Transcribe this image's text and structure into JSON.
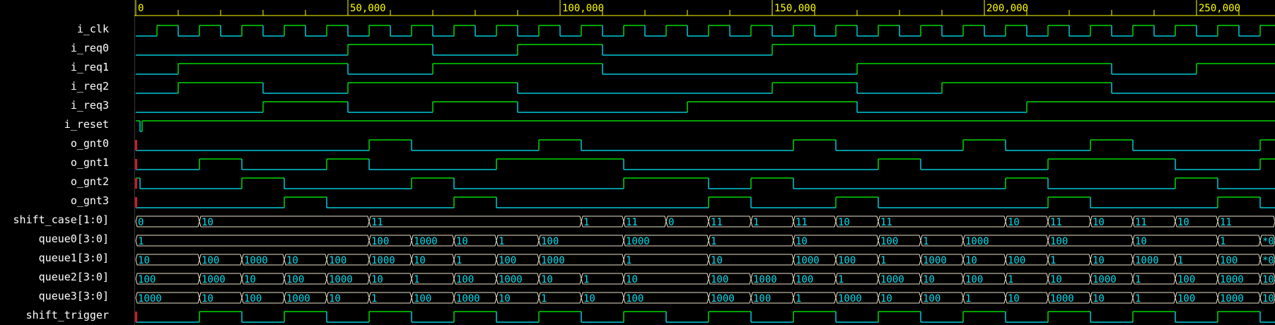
{
  "colors": {
    "background": "#000000",
    "ruler": "#ffff00",
    "wave_high": "#00d800",
    "wave_low": "#00c8d8",
    "bus_border": "#e8e0c8",
    "bus_text": "#00e0f0",
    "name_text": "#ffffff",
    "marker": "#d01830"
  },
  "ruler": {
    "t_min": 0,
    "t_max": 270000,
    "labels": [
      {
        "t": 0,
        "text": "0"
      },
      {
        "t": 50000,
        "text": "50,000"
      },
      {
        "t": 100000,
        "text": "100,000"
      },
      {
        "t": 150000,
        "text": "150,000"
      },
      {
        "t": 200000,
        "text": "200,000"
      },
      {
        "t": 250000,
        "text": "250,000"
      }
    ]
  },
  "signals": [
    {
      "name": "i_clk",
      "kind": "bit",
      "edges": [
        [
          0,
          0
        ],
        [
          5000,
          1
        ],
        [
          10000,
          0
        ],
        [
          15000,
          1
        ],
        [
          20000,
          0
        ],
        [
          25000,
          1
        ],
        [
          30000,
          0
        ],
        [
          35000,
          1
        ],
        [
          40000,
          0
        ],
        [
          45000,
          1
        ],
        [
          50000,
          0
        ],
        [
          55000,
          1
        ],
        [
          60000,
          0
        ],
        [
          65000,
          1
        ],
        [
          70000,
          0
        ],
        [
          75000,
          1
        ],
        [
          80000,
          0
        ],
        [
          85000,
          1
        ],
        [
          90000,
          0
        ],
        [
          95000,
          1
        ],
        [
          100000,
          0
        ],
        [
          105000,
          1
        ],
        [
          110000,
          0
        ],
        [
          115000,
          1
        ],
        [
          120000,
          0
        ],
        [
          125000,
          1
        ],
        [
          130000,
          0
        ],
        [
          135000,
          1
        ],
        [
          140000,
          0
        ],
        [
          145000,
          1
        ],
        [
          150000,
          0
        ],
        [
          155000,
          1
        ],
        [
          160000,
          0
        ],
        [
          165000,
          1
        ],
        [
          170000,
          0
        ],
        [
          175000,
          1
        ],
        [
          180000,
          0
        ],
        [
          185000,
          1
        ],
        [
          190000,
          0
        ],
        [
          195000,
          1
        ],
        [
          200000,
          0
        ],
        [
          205000,
          1
        ],
        [
          210000,
          0
        ],
        [
          215000,
          1
        ],
        [
          220000,
          0
        ],
        [
          225000,
          1
        ],
        [
          230000,
          0
        ],
        [
          235000,
          1
        ],
        [
          240000,
          0
        ],
        [
          245000,
          1
        ],
        [
          250000,
          0
        ],
        [
          255000,
          1
        ],
        [
          260000,
          0
        ],
        [
          265000,
          1
        ]
      ]
    },
    {
      "name": "i_req0",
      "kind": "bit",
      "edges": [
        [
          0,
          0
        ],
        [
          50000,
          1
        ],
        [
          70000,
          0
        ],
        [
          90000,
          1
        ],
        [
          110000,
          0
        ],
        [
          150000,
          1
        ]
      ]
    },
    {
      "name": "i_req1",
      "kind": "bit",
      "edges": [
        [
          0,
          0
        ],
        [
          10000,
          1
        ],
        [
          50000,
          0
        ],
        [
          70000,
          1
        ],
        [
          110000,
          0
        ],
        [
          170000,
          1
        ],
        [
          230000,
          0
        ],
        [
          250000,
          1
        ]
      ]
    },
    {
      "name": "i_req2",
      "kind": "bit",
      "edges": [
        [
          0,
          0
        ],
        [
          10000,
          1
        ],
        [
          30000,
          0
        ],
        [
          50000,
          1
        ],
        [
          90000,
          0
        ],
        [
          150000,
          1
        ],
        [
          170000,
          0
        ],
        [
          190000,
          1
        ],
        [
          230000,
          0
        ]
      ]
    },
    {
      "name": "i_req3",
      "kind": "bit",
      "edges": [
        [
          0,
          0
        ],
        [
          30000,
          1
        ],
        [
          50000,
          0
        ],
        [
          70000,
          1
        ],
        [
          90000,
          0
        ],
        [
          130000,
          1
        ],
        [
          170000,
          0
        ],
        [
          210000,
          1
        ]
      ]
    },
    {
      "name": "i_reset",
      "kind": "bit",
      "edges": [
        [
          0,
          1
        ],
        [
          1000,
          0
        ],
        [
          1500,
          1
        ]
      ]
    },
    {
      "name": "o_gnt0",
      "kind": "bit",
      "marker": true,
      "edges": [
        [
          0,
          0
        ],
        [
          55000,
          1
        ],
        [
          65000,
          0
        ],
        [
          95000,
          1
        ],
        [
          105000,
          0
        ],
        [
          155000,
          1
        ],
        [
          165000,
          0
        ],
        [
          195000,
          1
        ],
        [
          205000,
          0
        ],
        [
          225000,
          1
        ],
        [
          235000,
          0
        ],
        [
          265000,
          1
        ]
      ]
    },
    {
      "name": "o_gnt1",
      "kind": "bit",
      "marker": true,
      "edges": [
        [
          0,
          0
        ],
        [
          15000,
          1
        ],
        [
          25000,
          0
        ],
        [
          45000,
          1
        ],
        [
          55000,
          0
        ],
        [
          85000,
          1
        ],
        [
          115000,
          0
        ],
        [
          175000,
          1
        ],
        [
          185000,
          0
        ],
        [
          215000,
          1
        ],
        [
          245000,
          0
        ],
        [
          265000,
          1
        ]
      ]
    },
    {
      "name": "o_gnt2",
      "kind": "bit",
      "marker": true,
      "edges": [
        [
          0,
          1
        ],
        [
          1000,
          0
        ],
        [
          25000,
          1
        ],
        [
          35000,
          0
        ],
        [
          65000,
          1
        ],
        [
          75000,
          0
        ],
        [
          115000,
          1
        ],
        [
          135000,
          0
        ],
        [
          145000,
          1
        ],
        [
          155000,
          0
        ],
        [
          205000,
          1
        ],
        [
          215000,
          0
        ],
        [
          245000,
          1
        ],
        [
          255000,
          0
        ]
      ]
    },
    {
      "name": "o_gnt3",
      "kind": "bit",
      "marker": true,
      "edges": [
        [
          0,
          0
        ],
        [
          35000,
          1
        ],
        [
          45000,
          0
        ],
        [
          75000,
          1
        ],
        [
          85000,
          0
        ],
        [
          135000,
          1
        ],
        [
          145000,
          0
        ],
        [
          165000,
          1
        ],
        [
          175000,
          0
        ],
        [
          215000,
          1
        ],
        [
          225000,
          0
        ],
        [
          255000,
          1
        ],
        [
          265000,
          0
        ]
      ]
    },
    {
      "name": "shift_case[1:0]",
      "kind": "bus",
      "segments": [
        [
          0,
          "0"
        ],
        [
          15000,
          "10"
        ],
        [
          55000,
          "11"
        ],
        [
          105000,
          "1"
        ],
        [
          115000,
          "11"
        ],
        [
          125000,
          "0"
        ],
        [
          135000,
          "11"
        ],
        [
          145000,
          "1"
        ],
        [
          155000,
          "11"
        ],
        [
          165000,
          "10"
        ],
        [
          175000,
          "11"
        ],
        [
          205000,
          "10"
        ],
        [
          215000,
          "11"
        ],
        [
          225000,
          "10"
        ],
        [
          235000,
          "11"
        ],
        [
          245000,
          "10"
        ],
        [
          255000,
          "11"
        ]
      ]
    },
    {
      "name": "queue0[3:0]",
      "kind": "bus",
      "segments": [
        [
          0,
          "1"
        ],
        [
          55000,
          "100"
        ],
        [
          65000,
          "1000"
        ],
        [
          75000,
          "10"
        ],
        [
          85000,
          "1"
        ],
        [
          95000,
          "100"
        ],
        [
          115000,
          "1000"
        ],
        [
          135000,
          "1"
        ],
        [
          155000,
          "10"
        ],
        [
          175000,
          "100"
        ],
        [
          185000,
          "1"
        ],
        [
          195000,
          "1000"
        ],
        [
          215000,
          "100"
        ],
        [
          235000,
          "10"
        ],
        [
          255000,
          "1"
        ],
        [
          265000,
          "*0"
        ]
      ]
    },
    {
      "name": "queue1[3:0]",
      "kind": "bus",
      "segments": [
        [
          0,
          "10"
        ],
        [
          15000,
          "100"
        ],
        [
          25000,
          "1000"
        ],
        [
          35000,
          "10"
        ],
        [
          45000,
          "100"
        ],
        [
          55000,
          "1000"
        ],
        [
          65000,
          "10"
        ],
        [
          75000,
          "1"
        ],
        [
          85000,
          "100"
        ],
        [
          95000,
          "1000"
        ],
        [
          115000,
          "1"
        ],
        [
          135000,
          "10"
        ],
        [
          155000,
          "1000"
        ],
        [
          165000,
          "100"
        ],
        [
          175000,
          "1"
        ],
        [
          185000,
          "1000"
        ],
        [
          195000,
          "10"
        ],
        [
          205000,
          "100"
        ],
        [
          215000,
          "1"
        ],
        [
          225000,
          "10"
        ],
        [
          235000,
          "1000"
        ],
        [
          245000,
          "1"
        ],
        [
          255000,
          "100"
        ],
        [
          265000,
          "*0"
        ]
      ]
    },
    {
      "name": "queue2[3:0]",
      "kind": "bus",
      "segments": [
        [
          0,
          "100"
        ],
        [
          15000,
          "1000"
        ],
        [
          25000,
          "10"
        ],
        [
          35000,
          "100"
        ],
        [
          45000,
          "1000"
        ],
        [
          55000,
          "10"
        ],
        [
          65000,
          "1"
        ],
        [
          75000,
          "100"
        ],
        [
          85000,
          "1000"
        ],
        [
          95000,
          "10"
        ],
        [
          105000,
          "1"
        ],
        [
          115000,
          "10"
        ],
        [
          135000,
          "100"
        ],
        [
          145000,
          "1000"
        ],
        [
          155000,
          "100"
        ],
        [
          165000,
          "1"
        ],
        [
          175000,
          "1000"
        ],
        [
          185000,
          "10"
        ],
        [
          195000,
          "100"
        ],
        [
          205000,
          "1"
        ],
        [
          215000,
          "10"
        ],
        [
          225000,
          "1000"
        ],
        [
          235000,
          "1"
        ],
        [
          245000,
          "100"
        ],
        [
          255000,
          "1000"
        ],
        [
          265000,
          "10"
        ]
      ]
    },
    {
      "name": "queue3[3:0]",
      "kind": "bus",
      "segments": [
        [
          0,
          "1000"
        ],
        [
          15000,
          "10"
        ],
        [
          25000,
          "100"
        ],
        [
          35000,
          "1000"
        ],
        [
          45000,
          "10"
        ],
        [
          55000,
          "1"
        ],
        [
          65000,
          "100"
        ],
        [
          75000,
          "1000"
        ],
        [
          85000,
          "10"
        ],
        [
          95000,
          "1"
        ],
        [
          105000,
          "10"
        ],
        [
          115000,
          "100"
        ],
        [
          135000,
          "1000"
        ],
        [
          145000,
          "100"
        ],
        [
          155000,
          "1"
        ],
        [
          165000,
          "1000"
        ],
        [
          175000,
          "10"
        ],
        [
          185000,
          "100"
        ],
        [
          195000,
          "1"
        ],
        [
          205000,
          "10"
        ],
        [
          215000,
          "1000"
        ],
        [
          225000,
          "10"
        ],
        [
          235000,
          "1"
        ],
        [
          245000,
          "100"
        ],
        [
          255000,
          "1000"
        ],
        [
          265000,
          "10"
        ]
      ]
    },
    {
      "name": "shift_trigger",
      "kind": "bit",
      "marker": true,
      "edges": [
        [
          0,
          0
        ],
        [
          15000,
          1
        ],
        [
          25000,
          0
        ],
        [
          35000,
          1
        ],
        [
          45000,
          0
        ],
        [
          55000,
          1
        ],
        [
          65000,
          0
        ],
        [
          75000,
          1
        ],
        [
          85000,
          0
        ],
        [
          95000,
          1
        ],
        [
          105000,
          0
        ],
        [
          115000,
          1
        ],
        [
          125000,
          0
        ],
        [
          135000,
          1
        ],
        [
          145000,
          0
        ],
        [
          155000,
          1
        ],
        [
          165000,
          0
        ],
        [
          175000,
          1
        ],
        [
          185000,
          0
        ],
        [
          195000,
          1
        ],
        [
          205000,
          0
        ],
        [
          215000,
          1
        ],
        [
          225000,
          0
        ],
        [
          235000,
          1
        ],
        [
          245000,
          0
        ],
        [
          255000,
          1
        ],
        [
          265000,
          0
        ]
      ]
    }
  ]
}
